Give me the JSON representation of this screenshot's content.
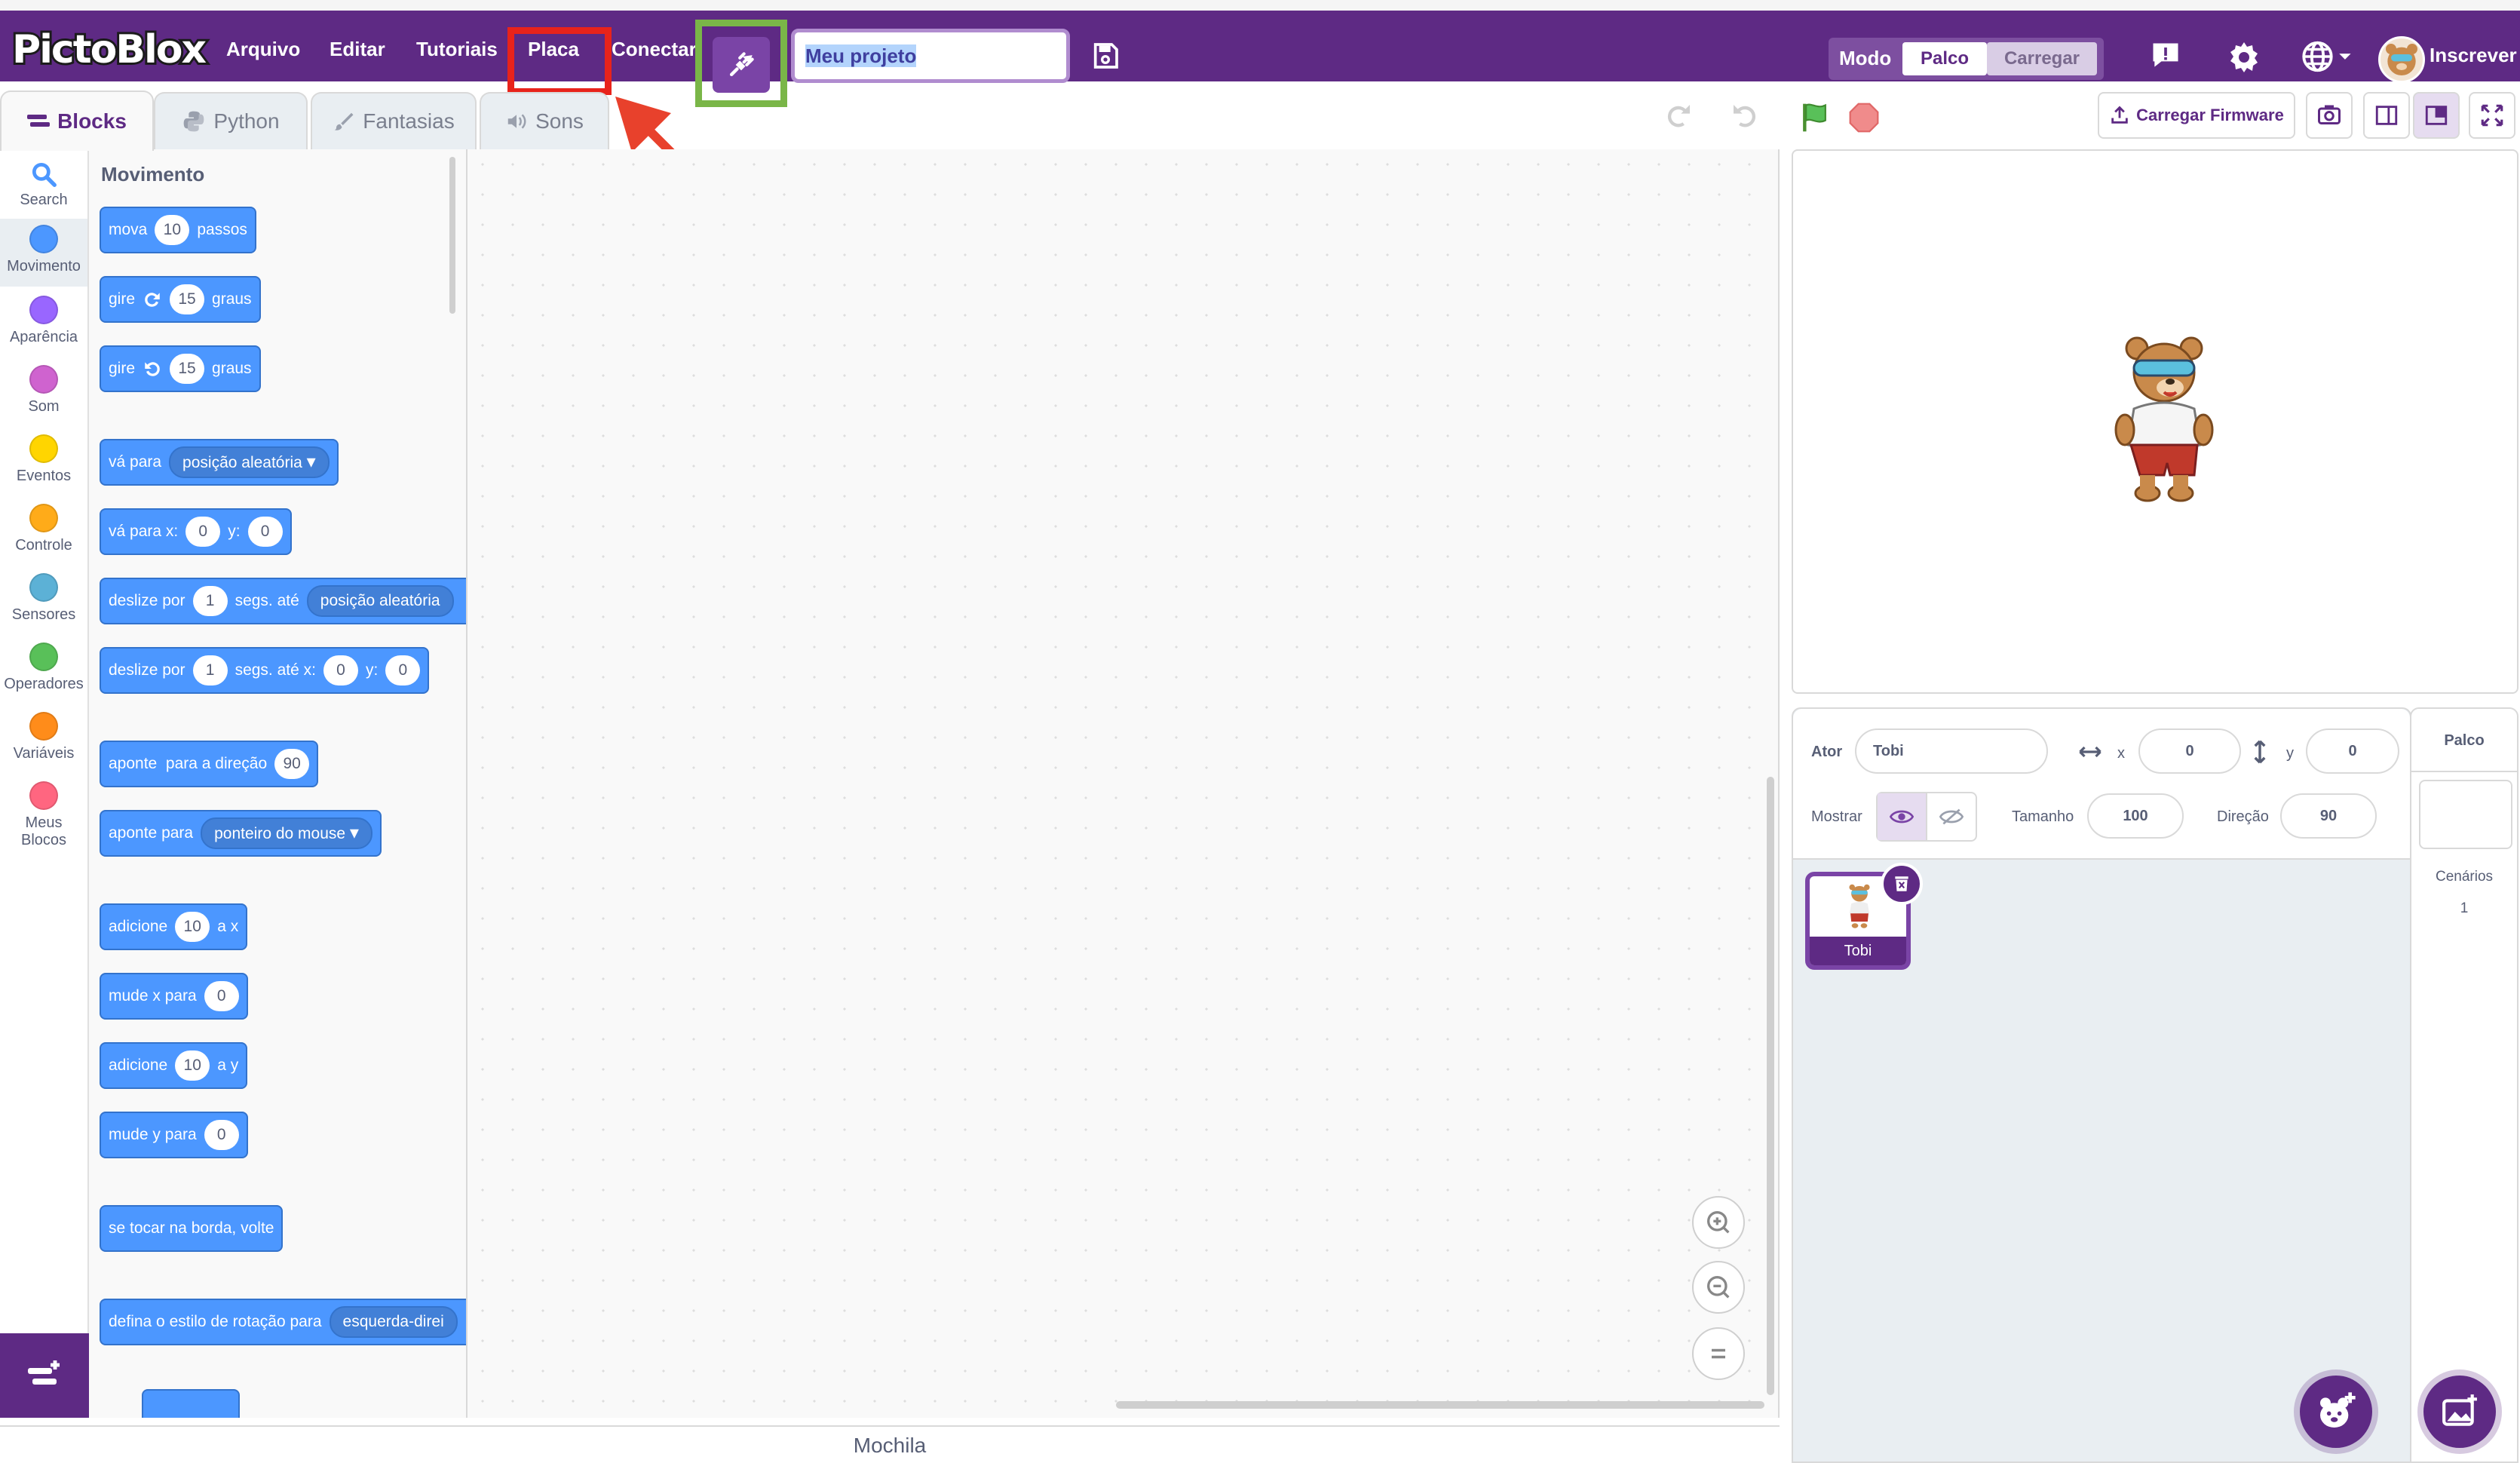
{
  "app": {
    "logo": "PictoBlox"
  },
  "menu": {
    "arquivo": "Arquivo",
    "editar": "Editar",
    "tutoriais": "Tutoriais",
    "placa": "Placa",
    "conectar": "Conectar"
  },
  "project": {
    "name": "Meu projeto"
  },
  "mode": {
    "label": "Modo",
    "palco": "Palco",
    "carregar": "Carregar"
  },
  "account": {
    "signup": "Inscrever"
  },
  "tabs": {
    "blocks": "Blocks",
    "python": "Python",
    "costumes": "Fantasias",
    "sounds": "Sons"
  },
  "categories": [
    {
      "label": "Search",
      "color": ""
    },
    {
      "label": "Movimento",
      "color": "#4c97ff"
    },
    {
      "label": "Aparência",
      "color": "#9966ff"
    },
    {
      "label": "Som",
      "color": "#cf63cf"
    },
    {
      "label": "Eventos",
      "color": "#ffd500"
    },
    {
      "label": "Controle",
      "color": "#ffab19"
    },
    {
      "label": "Sensores",
      "color": "#5cb1d6"
    },
    {
      "label": "Operadores",
      "color": "#59c059"
    },
    {
      "label": "Variáveis",
      "color": "#ff8c1a"
    },
    {
      "label": "Meus Blocos",
      "color": "#ff6680"
    }
  ],
  "palette": {
    "title": "Movimento",
    "blocks": {
      "move": {
        "a": "mova",
        "n": "10",
        "b": "passos"
      },
      "turn_right": {
        "a": "gire",
        "n": "15",
        "b": "graus"
      },
      "turn_left": {
        "a": "gire",
        "n": "15",
        "b": "graus"
      },
      "goto": {
        "a": "vá para",
        "drop": "posição aleatória"
      },
      "goto_xy": {
        "a": "vá para x:",
        "x": "0",
        "b": "y:",
        "y": "0"
      },
      "glide_to": {
        "a": "deslize por",
        "n": "1",
        "b": "segs. até",
        "drop": "posição aleatória"
      },
      "glide_xy": {
        "a": "deslize por",
        "n": "1",
        "b": "segs. até x:",
        "x": "0",
        "c": "y:",
        "y": "0"
      },
      "point_dir": {
        "a": "aponte  para a direção",
        "n": "90"
      },
      "point_towards": {
        "a": "aponte para",
        "drop": "ponteiro do mouse"
      },
      "change_x": {
        "a": "adicione",
        "n": "10",
        "b": "a x"
      },
      "set_x": {
        "a": "mude x para",
        "n": "0"
      },
      "change_y": {
        "a": "adicione",
        "n": "10",
        "b": "a y"
      },
      "set_y": {
        "a": "mude y para",
        "n": "0"
      },
      "bounce": {
        "a": "se tocar na borda, volte"
      },
      "rotation_style": {
        "a": "defina o estilo de rotação para",
        "drop": "esquerda-direi"
      }
    }
  },
  "backpack": {
    "label": "Mochila"
  },
  "stage_header": {
    "firmware": "Carregar Firmware"
  },
  "sprite_info": {
    "sprite_label": "Ator",
    "sprite_name": "Tobi",
    "x_label": "x",
    "x_value": "0",
    "y_label": "y",
    "y_value": "0",
    "show_label": "Mostrar",
    "size_label": "Tamanho",
    "size_value": "100",
    "direction_label": "Direção",
    "direction_value": "90"
  },
  "sprites": [
    {
      "name": "Tobi"
    }
  ],
  "stage_pane": {
    "title": "Palco",
    "backdrops_label": "Cenários",
    "backdrops_count": "1"
  },
  "colors": {
    "brand": "#5e2a84",
    "motion": "#4c97ff",
    "highlight_red": "#e8231b",
    "highlight_green": "#7ab648"
  }
}
